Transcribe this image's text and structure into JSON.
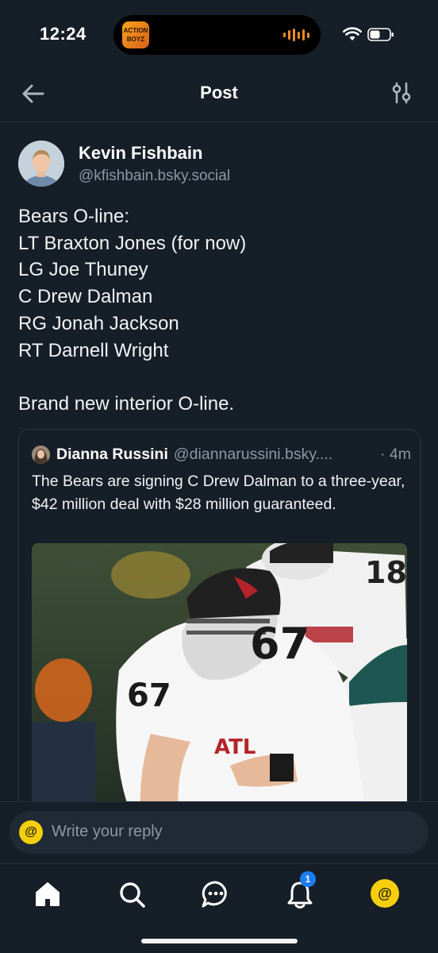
{
  "status_bar": {
    "time": "12:24",
    "app_badge_text": "ACTION BOYZ",
    "icons": [
      "wifi-icon",
      "battery-icon"
    ]
  },
  "header": {
    "title": "Post",
    "back_icon": "arrow-left-icon",
    "settings_icon": "sliders-icon"
  },
  "post": {
    "author_name": "Kevin Fishbain",
    "author_handle": "@kfishbain.bsky.social",
    "text_lines": [
      "Bears O-line:",
      "LT Braxton Jones (for now)",
      "LG Joe Thuney",
      "C Drew Dalman",
      "RG Jonah Jackson",
      "RT Darnell Wright",
      "",
      "Brand new interior O-line."
    ],
    "quote": {
      "author_name": "Dianna Russini",
      "author_handle": "@diannarussini.bsky....",
      "time": "· 4m",
      "text": "The Bears are signing C Drew Dalman to a three-year, $42 million deal with $28 million guaranteed.",
      "image_subject": "Atlanta Falcons offensive lineman #67 in white jersey and black helmet crouched at the line of scrimmage"
    }
  },
  "reply": {
    "placeholder": "Write your reply",
    "avatar_glyph": "@"
  },
  "bottom_nav": {
    "items": [
      {
        "name": "home",
        "icon": "home-icon"
      },
      {
        "name": "search",
        "icon": "search-icon"
      },
      {
        "name": "chat",
        "icon": "chat-icon"
      },
      {
        "name": "notifications",
        "icon": "bell-icon",
        "badge": "1"
      },
      {
        "name": "profile",
        "icon": "avatar",
        "glyph": "@"
      }
    ]
  },
  "colors": {
    "background": "#161e27",
    "text_primary": "#f1f3f5",
    "text_secondary": "#8b98a6",
    "accent_badge": "#1b7df2",
    "avatar_yellow": "#f5cf0d",
    "divider": "#27313c"
  }
}
